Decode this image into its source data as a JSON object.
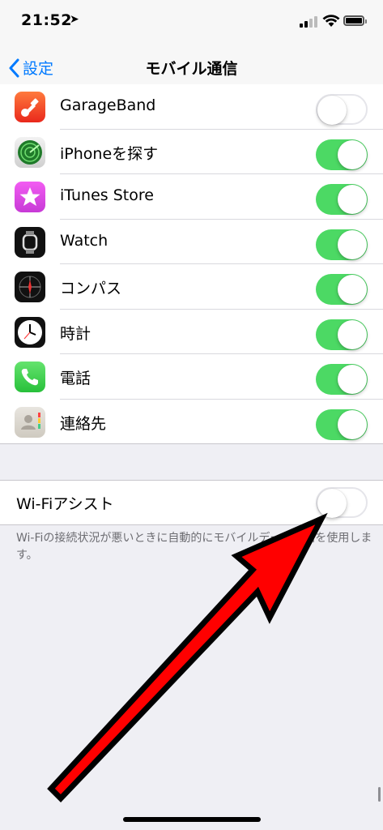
{
  "status": {
    "time": "21:52"
  },
  "nav": {
    "back_label": "設定",
    "title": "モバイル通信"
  },
  "apps": [
    {
      "label": "GarageBand",
      "icon": "garageband-icon",
      "enabled": false
    },
    {
      "label": "iPhoneを探す",
      "icon": "find-iphone-icon",
      "enabled": true
    },
    {
      "label": "iTunes Store",
      "icon": "itunes-store-icon",
      "enabled": true
    },
    {
      "label": "Watch",
      "icon": "watch-icon",
      "enabled": true
    },
    {
      "label": "コンパス",
      "icon": "compass-icon",
      "enabled": true
    },
    {
      "label": "時計",
      "icon": "clock-icon",
      "enabled": true
    },
    {
      "label": "電話",
      "icon": "phone-icon",
      "enabled": true
    },
    {
      "label": "連絡先",
      "icon": "contacts-icon",
      "enabled": true
    }
  ],
  "wifi_assist": {
    "label": "Wi-Fiアシスト",
    "enabled": false,
    "description": "Wi-Fiの接続状況が悪いときに自動的にモバイルデータ通信を使用します。"
  },
  "colors": {
    "accent": "#007aff",
    "toggle_on": "#4cd964",
    "arrow": "#ff0000"
  }
}
